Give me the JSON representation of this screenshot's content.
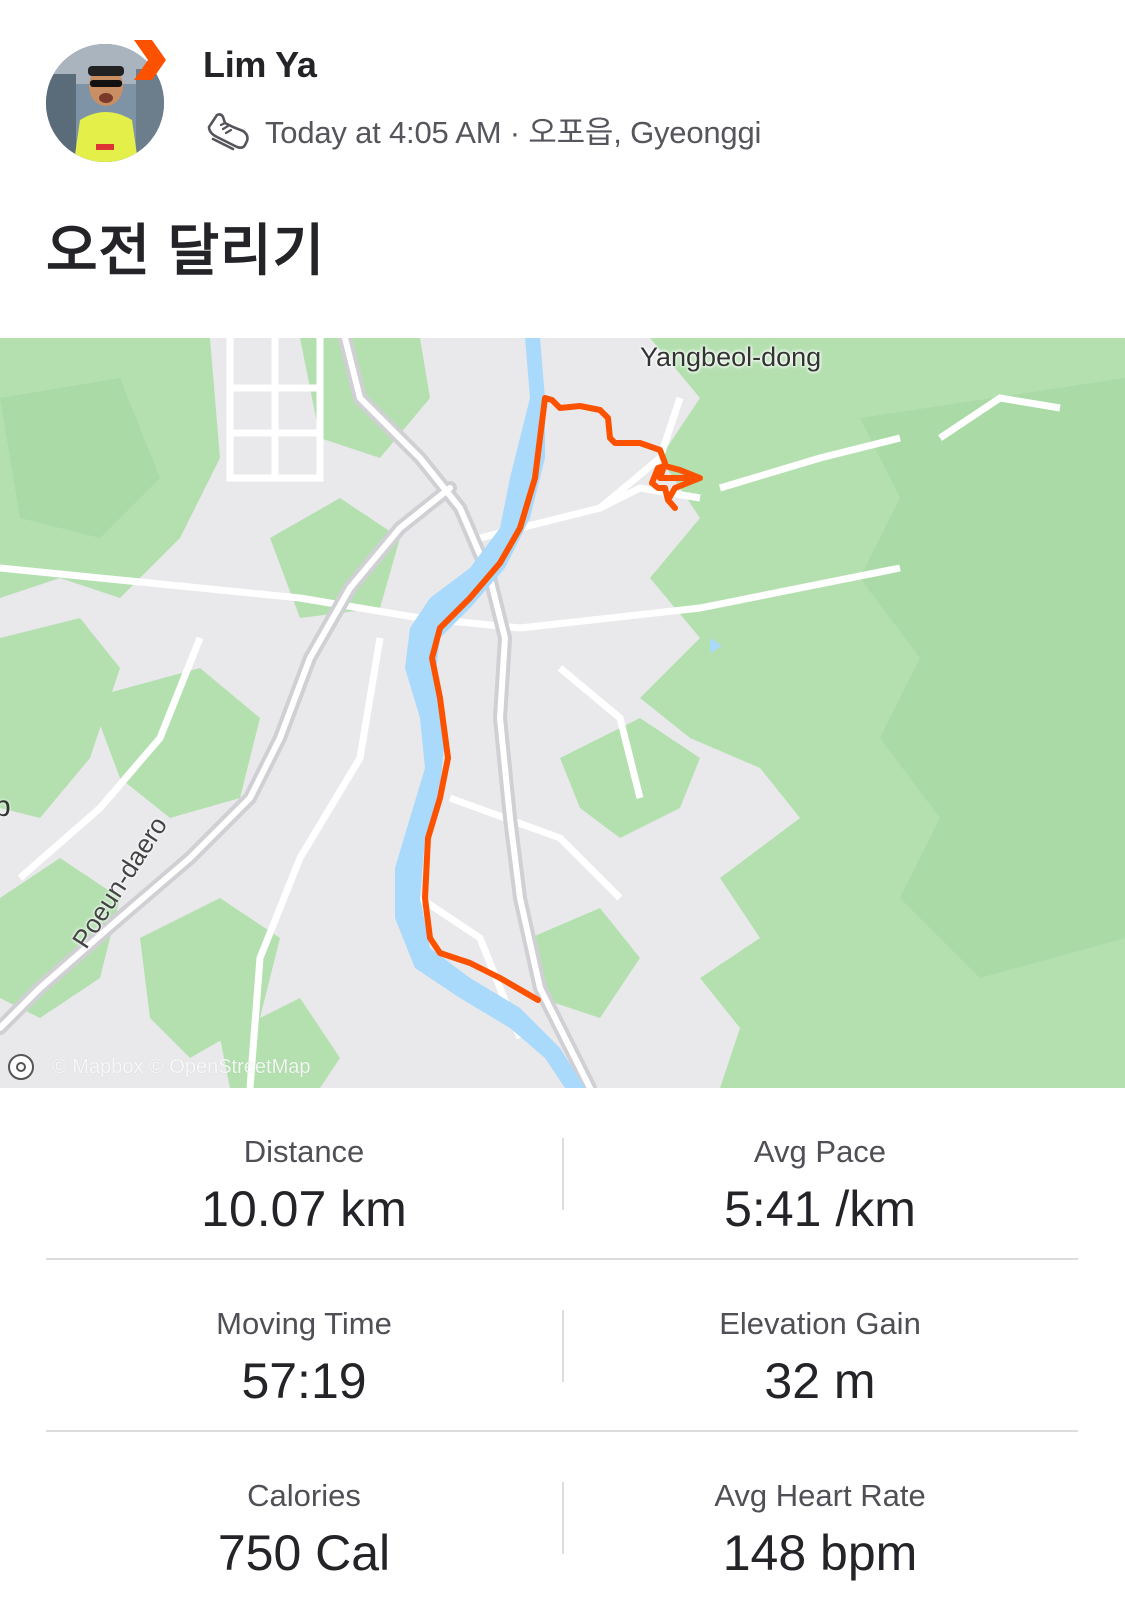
{
  "header": {
    "user_name": "Lim Ya",
    "meta": "Today at 4:05 AM · 오포읍, Gyeonggi",
    "activity_icon": "running-shoe-icon",
    "avatar": "user-avatar",
    "badge": "subscriber-badge-icon"
  },
  "activity": {
    "title": "오전 달리기"
  },
  "map": {
    "place_label": "Yangbeol-dong",
    "road_label": "Poeun-daero",
    "edge_label": "p",
    "attribution": "© Mapbox © OpenStreetMap",
    "route_color": "#fc5200",
    "water_color": "#a9d9fb",
    "forest_color": "#b4e0b0"
  },
  "stats": [
    {
      "label": "Distance",
      "value": "10.07 km"
    },
    {
      "label": "Avg Pace",
      "value": "5:41 /km"
    },
    {
      "label": "Moving Time",
      "value": "57:19"
    },
    {
      "label": "Elevation Gain",
      "value": "32 m"
    },
    {
      "label": "Calories",
      "value": "750 Cal"
    },
    {
      "label": "Avg Heart Rate",
      "value": "148 bpm"
    }
  ]
}
